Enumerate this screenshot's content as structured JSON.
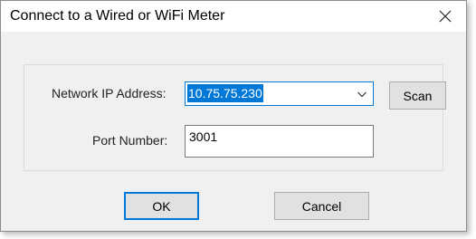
{
  "dialog": {
    "title": "Connect to a Wired or WiFi Meter",
    "close_icon": "close-icon"
  },
  "form": {
    "ip_label": "Network IP Address:",
    "ip_value": "10.75.75.230",
    "scan_label": "Scan",
    "port_label": "Port Number:",
    "port_value": "3001"
  },
  "buttons": {
    "ok_label": "OK",
    "cancel_label": "Cancel"
  },
  "colors": {
    "accent": "#0078d7",
    "dialog_bg": "#f0f0f0",
    "button_bg": "#e1e1e1"
  }
}
